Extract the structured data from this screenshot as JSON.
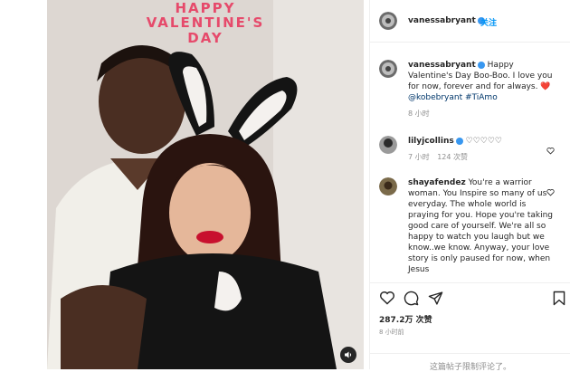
{
  "photo": {
    "overlay_line1": "HAPPY",
    "overlay_line2": "VALENTINE'S",
    "overlay_line3": "DAY"
  },
  "header": {
    "username": "vanessabryant",
    "follow_label": "关注"
  },
  "comments": [
    {
      "username": "vanessabryant",
      "text": "Happy Valentine's Day Boo-Boo. I love you for now, forever and for always.",
      "emoji": "❤️",
      "mention": "@kobebryant",
      "hashtag": "#TiAmo",
      "time": "8 小时"
    },
    {
      "username": "lilyjcollins",
      "text": "♡♡♡♡♡",
      "time": "7 小时",
      "likes": "124 次赞"
    },
    {
      "username": "shayafendez",
      "text": "You're a warrior woman. You Inspire so many of us everyday. The whole world is praying for you. Hope you're taking good care of yourself. We're all so happy to watch you laugh but we know..we know. Anyway, your love story is only paused for now, when Jesus"
    }
  ],
  "actions": {
    "like_count": "287.2万 次赞",
    "posted_ago": "8 小时前",
    "comments_limited": "这篇帖子限制评论了。"
  },
  "colors": {
    "accent_blue": "#0095f6",
    "verified_blue": "#3897f0",
    "heart_red": "#ed4956",
    "overlay_pink": "#e64a6b"
  }
}
